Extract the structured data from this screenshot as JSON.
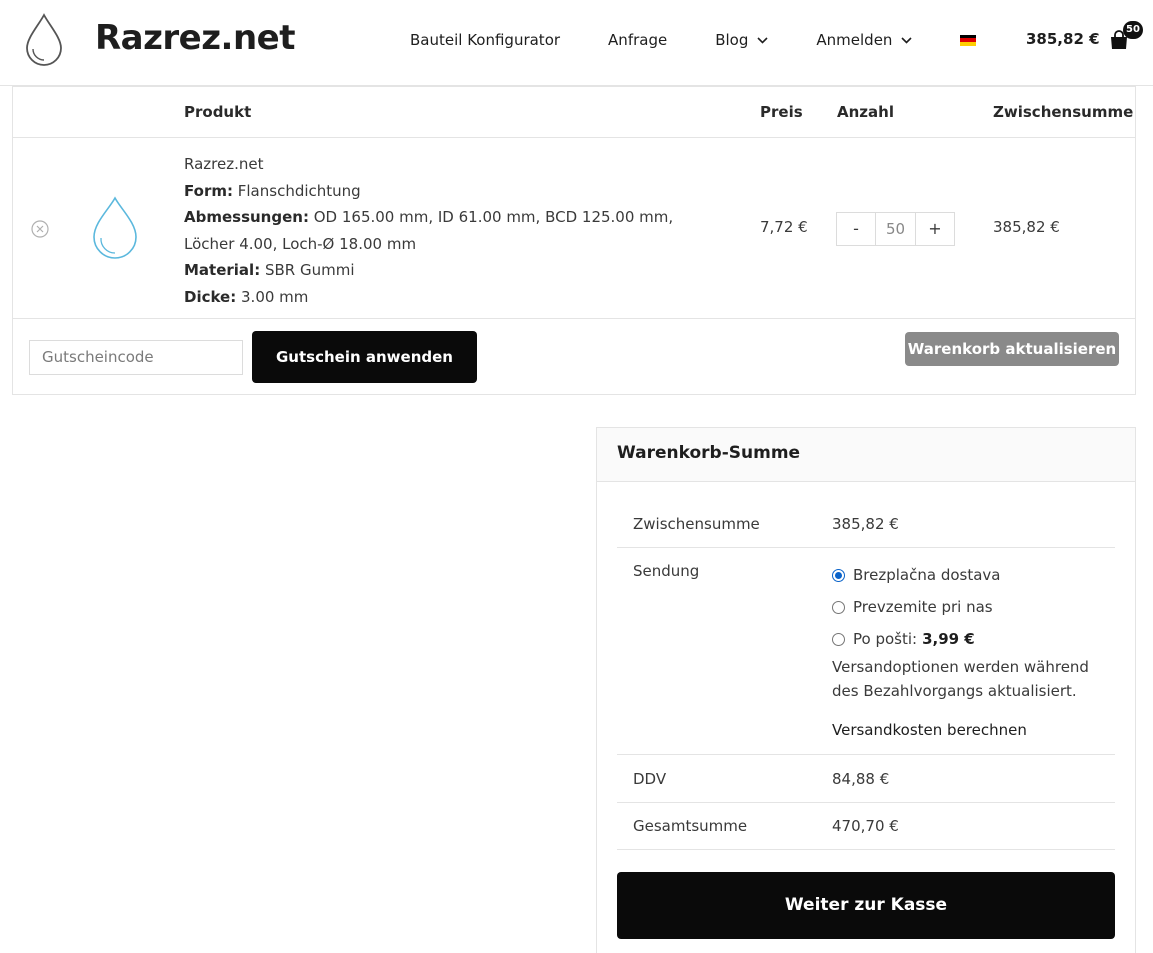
{
  "header": {
    "logo_text": "Razrez.net",
    "nav": [
      {
        "label": "Bauteil Konfigurator"
      },
      {
        "label": "Anfrage"
      },
      {
        "label": "Blog"
      },
      {
        "label": "Anmelden"
      }
    ],
    "language_flag": "german-flag-icon",
    "cart_total": "385,82 €",
    "cart_count": "50"
  },
  "cart": {
    "headers": {
      "product": "Produkt",
      "price": "Preis",
      "quantity": "Anzahl",
      "subtotal": "Zwischensumme"
    },
    "item": {
      "title": "Razrez.net",
      "form_label": "Form:",
      "form_value": "Flanschdichtung",
      "dimensions_label": "Abmessungen:",
      "dimensions_value": "OD 165.00 mm, ID 61.00 mm, BCD 125.00 mm, Löcher 4.00, Loch-Ø 18.00 mm",
      "material_label": "Material:",
      "material_value": "SBR Gummi",
      "thickness_label": "Dicke:",
      "thickness_value": "3.00 mm",
      "price": "7,72 €",
      "quantity": "50",
      "qty_minus": "-",
      "qty_plus": "+",
      "subtotal": "385,82 €"
    },
    "coupon_placeholder": "Gutscheincode",
    "coupon_button": "Gutschein anwenden",
    "update_button": "Warenkorb aktualisieren"
  },
  "totals": {
    "title": "Warenkorb-Summe",
    "subtotal_label": "Zwischensumme",
    "subtotal_value": "385,82 €",
    "shipping_label": "Sendung",
    "shipping_options": [
      {
        "label": "Brezplačna dostava",
        "selected": true
      },
      {
        "label": "Prevzemite pri nas",
        "selected": false
      },
      {
        "label": "Po pošti:",
        "price": "3,99 €",
        "selected": false
      }
    ],
    "shipping_note": "Versandoptionen werden während des Bezahlvorgangs aktualisiert.",
    "shipping_calc": "Versandkosten berechnen",
    "tax_label": "DDV",
    "tax_value": "84,88 €",
    "total_label": "Gesamtsumme",
    "total_value": "470,70 €",
    "checkout_button": "Weiter zur Kasse"
  },
  "colors": {
    "primary_button": "#0a0a0a",
    "disabled_button": "#8a8a8a",
    "accent_drop": "#5bb8dd",
    "radio_selected": "#0a63c9"
  }
}
